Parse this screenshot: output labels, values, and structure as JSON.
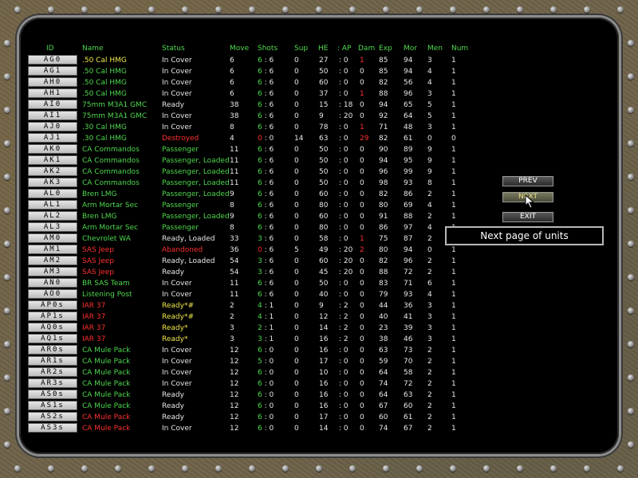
{
  "headers": {
    "id": "ID",
    "name": "Name",
    "status": "Status",
    "move": "Move",
    "shots": "Shots",
    "sup": "Sup",
    "he": "HE",
    "ap": ": AP",
    "dam": "Dam",
    "exp": "Exp",
    "mor": "Mor",
    "men": "Men",
    "num": "Num"
  },
  "buttons": {
    "prev": "PREV",
    "next": "NEXT",
    "exit": "EXIT"
  },
  "tooltip": "Next page of units",
  "colors": {
    "green": "#4fd84f",
    "red": "#ff3030",
    "yellow": "#f0e84a",
    "white": "#e8e8e8"
  },
  "units": [
    {
      "id": "AG0",
      "name": ".50 Cal HMG",
      "nc": "yellow",
      "status": "In Cover",
      "sc": "white",
      "move": "6",
      "sh1": "6",
      "sh1c": "green",
      "sh2": "6",
      "sup": "0",
      "he": "27",
      "ap": "0",
      "dam": "1",
      "damc": "red",
      "exp": "85",
      "mor": "94",
      "men": "3",
      "num": "1"
    },
    {
      "id": "AG1",
      "name": ".50 Cal HMG",
      "nc": "green",
      "status": "In Cover",
      "sc": "white",
      "move": "6",
      "sh1": "6",
      "sh1c": "green",
      "sh2": "6",
      "sup": "0",
      "he": "50",
      "ap": "0",
      "dam": "0",
      "damc": "white",
      "exp": "85",
      "mor": "94",
      "men": "4",
      "num": "1"
    },
    {
      "id": "AH0",
      "name": ".50 Cal HMG",
      "nc": "green",
      "status": "In Cover",
      "sc": "white",
      "move": "6",
      "sh1": "6",
      "sh1c": "green",
      "sh2": "6",
      "sup": "0",
      "he": "60",
      "ap": "0",
      "dam": "0",
      "damc": "white",
      "exp": "82",
      "mor": "56",
      "men": "4",
      "num": "1"
    },
    {
      "id": "AH1",
      "name": ".50 Cal HMG",
      "nc": "green",
      "status": "In Cover",
      "sc": "white",
      "move": "6",
      "sh1": "6",
      "sh1c": "green",
      "sh2": "6",
      "sup": "0",
      "he": "37",
      "ap": "0",
      "dam": "1",
      "damc": "red",
      "exp": "88",
      "mor": "96",
      "men": "3",
      "num": "1"
    },
    {
      "id": "AI0",
      "name": "75mm M3A1 GMC",
      "nc": "green",
      "status": "Ready",
      "sc": "white",
      "move": "38",
      "sh1": "6",
      "sh1c": "green",
      "sh2": "6",
      "sup": "0",
      "he": "15",
      "ap": "18",
      "dam": "0",
      "damc": "white",
      "exp": "94",
      "mor": "65",
      "men": "5",
      "num": "1"
    },
    {
      "id": "AI1",
      "name": "75mm M3A1 GMC",
      "nc": "green",
      "status": "In Cover",
      "sc": "white",
      "move": "38",
      "sh1": "6",
      "sh1c": "green",
      "sh2": "6",
      "sup": "0",
      "he": "9",
      "ap": "20",
      "dam": "0",
      "damc": "white",
      "exp": "92",
      "mor": "64",
      "men": "5",
      "num": "1"
    },
    {
      "id": "AJ0",
      "name": ".30 Cal HMG",
      "nc": "green",
      "status": "In Cover",
      "sc": "white",
      "move": "8",
      "sh1": "6",
      "sh1c": "green",
      "sh2": "6",
      "sup": "0",
      "he": "78",
      "ap": "0",
      "dam": "1",
      "damc": "red",
      "exp": "71",
      "mor": "48",
      "men": "3",
      "num": "1"
    },
    {
      "id": "AJ1",
      "name": ".30 Cal HMG",
      "nc": "green",
      "status": "Destroyed",
      "sc": "red",
      "move": "4",
      "sh1": "0",
      "sh1c": "red",
      "sh2": "0",
      "sup": "14",
      "he": "63",
      "ap": "0",
      "dam": "29",
      "damc": "red",
      "exp": "82",
      "mor": "61",
      "men": "0",
      "num": "0"
    },
    {
      "id": "AK0",
      "name": "CA Commandos",
      "nc": "green",
      "status": "Passenger",
      "sc": "green",
      "move": "11",
      "sh1": "6",
      "sh1c": "green",
      "sh2": "6",
      "sup": "0",
      "he": "50",
      "ap": "0",
      "dam": "0",
      "damc": "white",
      "exp": "90",
      "mor": "89",
      "men": "9",
      "num": "1"
    },
    {
      "id": "AK1",
      "name": "CA Commandos",
      "nc": "green",
      "status": "Passenger,  Loaded",
      "sc": "green",
      "move": "11",
      "sh1": "6",
      "sh1c": "green",
      "sh2": "6",
      "sup": "0",
      "he": "50",
      "ap": "0",
      "dam": "0",
      "damc": "white",
      "exp": "94",
      "mor": "95",
      "men": "9",
      "num": "1"
    },
    {
      "id": "AK2",
      "name": "CA Commandos",
      "nc": "green",
      "status": "Passenger,  Loaded",
      "sc": "green",
      "move": "11",
      "sh1": "6",
      "sh1c": "green",
      "sh2": "6",
      "sup": "0",
      "he": "50",
      "ap": "0",
      "dam": "0",
      "damc": "white",
      "exp": "96",
      "mor": "99",
      "men": "9",
      "num": "1"
    },
    {
      "id": "AK3",
      "name": "CA Commandos",
      "nc": "green",
      "status": "Passenger,  Loaded",
      "sc": "green",
      "move": "11",
      "sh1": "6",
      "sh1c": "green",
      "sh2": "6",
      "sup": "0",
      "he": "50",
      "ap": "0",
      "dam": "0",
      "damc": "white",
      "exp": "98",
      "mor": "93",
      "men": "8",
      "num": "1"
    },
    {
      "id": "AL0",
      "name": "Bren LMG",
      "nc": "green",
      "status": "Passenger,  Loaded",
      "sc": "green",
      "move": "9",
      "sh1": "6",
      "sh1c": "green",
      "sh2": "6",
      "sup": "0",
      "he": "60",
      "ap": "0",
      "dam": "0",
      "damc": "white",
      "exp": "82",
      "mor": "86",
      "men": "2",
      "num": "1"
    },
    {
      "id": "AL1",
      "name": "Arm Mortar Sec",
      "nc": "green",
      "status": "Passenger",
      "sc": "green",
      "move": "8",
      "sh1": "6",
      "sh1c": "green",
      "sh2": "6",
      "sup": "0",
      "he": "80",
      "ap": "0",
      "dam": "0",
      "damc": "white",
      "exp": "80",
      "mor": "69",
      "men": "4",
      "num": "1"
    },
    {
      "id": "AL2",
      "name": "Bren LMG",
      "nc": "green",
      "status": "Passenger,  Loaded",
      "sc": "green",
      "move": "9",
      "sh1": "6",
      "sh1c": "green",
      "sh2": "6",
      "sup": "0",
      "he": "60",
      "ap": "0",
      "dam": "0",
      "damc": "white",
      "exp": "91",
      "mor": "88",
      "men": "2",
      "num": "1"
    },
    {
      "id": "AL3",
      "name": "Arm Mortar Sec",
      "nc": "green",
      "status": "Passenger",
      "sc": "green",
      "move": "8",
      "sh1": "6",
      "sh1c": "green",
      "sh2": "6",
      "sup": "0",
      "he": "80",
      "ap": "0",
      "dam": "0",
      "damc": "white",
      "exp": "86",
      "mor": "97",
      "men": "4",
      "num": "1"
    },
    {
      "id": "AM0",
      "name": "Chevrolet WA",
      "nc": "green",
      "status": "Ready,  Loaded",
      "sc": "white",
      "move": "33",
      "sh1": "3",
      "sh1c": "green",
      "sh2": "6",
      "sup": "0",
      "he": "58",
      "ap": "0",
      "dam": "1",
      "damc": "red",
      "exp": "75",
      "mor": "87",
      "men": "2",
      "num": "1"
    },
    {
      "id": "AM1",
      "name": "SAS Jeep",
      "nc": "red",
      "status": "Abandoned",
      "sc": "red",
      "move": "36",
      "sh1": "0",
      "sh1c": "red",
      "sh2": "6",
      "sup": "5",
      "he": "49",
      "ap": "20",
      "dam": "2",
      "damc": "red",
      "exp": "80",
      "mor": "94",
      "men": "0",
      "num": "1"
    },
    {
      "id": "AM2",
      "name": "SAS Jeep",
      "nc": "red",
      "status": "Ready,  Loaded",
      "sc": "white",
      "move": "54",
      "sh1": "3",
      "sh1c": "green",
      "sh2": "6",
      "sup": "0",
      "he": "60",
      "ap": "20",
      "dam": "0",
      "damc": "white",
      "exp": "82",
      "mor": "96",
      "men": "2",
      "num": "1"
    },
    {
      "id": "AM3",
      "name": "SAS Jeep",
      "nc": "red",
      "status": "Ready",
      "sc": "white",
      "move": "54",
      "sh1": "3",
      "sh1c": "green",
      "sh2": "6",
      "sup": "0",
      "he": "45",
      "ap": "20",
      "dam": "0",
      "damc": "white",
      "exp": "88",
      "mor": "72",
      "men": "2",
      "num": "1"
    },
    {
      "id": "AN0",
      "name": "BR SAS Team",
      "nc": "green",
      "status": "In Cover",
      "sc": "white",
      "move": "11",
      "sh1": "6",
      "sh1c": "green",
      "sh2": "6",
      "sup": "0",
      "he": "50",
      "ap": "0",
      "dam": "0",
      "damc": "white",
      "exp": "83",
      "mor": "71",
      "men": "6",
      "num": "1"
    },
    {
      "id": "AO0",
      "name": "Listening Post",
      "nc": "green",
      "status": "In Cover",
      "sc": "white",
      "move": "11",
      "sh1": "6",
      "sh1c": "green",
      "sh2": "6",
      "sup": "0",
      "he": "40",
      "ap": "0",
      "dam": "0",
      "damc": "white",
      "exp": "79",
      "mor": "93",
      "men": "4",
      "num": "1"
    },
    {
      "id": "AP0s",
      "name": "IAR 37",
      "nc": "red",
      "status": "Ready*#",
      "sc": "yellow",
      "move": "2",
      "sh1": "4",
      "sh1c": "green",
      "sh2": "1",
      "sup": "0",
      "he": "9",
      "ap": "2",
      "dam": "0",
      "damc": "white",
      "exp": "44",
      "mor": "36",
      "men": "3",
      "num": "1"
    },
    {
      "id": "AP1s",
      "name": "IAR 37",
      "nc": "red",
      "status": "Ready*#",
      "sc": "yellow",
      "move": "2",
      "sh1": "4",
      "sh1c": "green",
      "sh2": "1",
      "sup": "0",
      "he": "12",
      "ap": "2",
      "dam": "0",
      "damc": "white",
      "exp": "40",
      "mor": "41",
      "men": "3",
      "num": "1"
    },
    {
      "id": "AQ0s",
      "name": "IAR 37",
      "nc": "red",
      "status": "Ready*",
      "sc": "yellow",
      "move": "3",
      "sh1": "2",
      "sh1c": "green",
      "sh2": "1",
      "sup": "0",
      "he": "14",
      "ap": "2",
      "dam": "0",
      "damc": "white",
      "exp": "23",
      "mor": "39",
      "men": "3",
      "num": "1"
    },
    {
      "id": "AQ1s",
      "name": "IAR 37",
      "nc": "red",
      "status": "Ready*",
      "sc": "yellow",
      "move": "3",
      "sh1": "3",
      "sh1c": "green",
      "sh2": "1",
      "sup": "0",
      "he": "16",
      "ap": "2",
      "dam": "0",
      "damc": "white",
      "exp": "38",
      "mor": "46",
      "men": "3",
      "num": "1"
    },
    {
      "id": "AR0s",
      "name": "CA Mule Pack",
      "nc": "green",
      "status": "In Cover",
      "sc": "white",
      "move": "12",
      "sh1": "6",
      "sh1c": "green",
      "sh2": "0",
      "sup": "0",
      "he": "16",
      "ap": "0",
      "dam": "0",
      "damc": "white",
      "exp": "63",
      "mor": "73",
      "men": "2",
      "num": "1"
    },
    {
      "id": "AR1s",
      "name": "CA Mule Pack",
      "nc": "green",
      "status": "In Cover",
      "sc": "white",
      "move": "12",
      "sh1": "5",
      "sh1c": "green",
      "sh2": "0",
      "sup": "0",
      "he": "17",
      "ap": "0",
      "dam": "0",
      "damc": "white",
      "exp": "59",
      "mor": "70",
      "men": "2",
      "num": "1"
    },
    {
      "id": "AR2s",
      "name": "CA Mule Pack",
      "nc": "green",
      "status": "In Cover",
      "sc": "white",
      "move": "12",
      "sh1": "6",
      "sh1c": "green",
      "sh2": "0",
      "sup": "0",
      "he": "10",
      "ap": "0",
      "dam": "0",
      "damc": "white",
      "exp": "64",
      "mor": "58",
      "men": "2",
      "num": "1"
    },
    {
      "id": "AR3s",
      "name": "CA Mule Pack",
      "nc": "green",
      "status": "In Cover",
      "sc": "white",
      "move": "12",
      "sh1": "6",
      "sh1c": "green",
      "sh2": "0",
      "sup": "0",
      "he": "16",
      "ap": "0",
      "dam": "0",
      "damc": "white",
      "exp": "74",
      "mor": "72",
      "men": "2",
      "num": "1"
    },
    {
      "id": "AS0s",
      "name": "CA Mule Pack",
      "nc": "green",
      "status": "Ready",
      "sc": "white",
      "move": "12",
      "sh1": "6",
      "sh1c": "green",
      "sh2": "0",
      "sup": "0",
      "he": "16",
      "ap": "0",
      "dam": "0",
      "damc": "white",
      "exp": "64",
      "mor": "63",
      "men": "2",
      "num": "1"
    },
    {
      "id": "AS1s",
      "name": "CA Mule Pack",
      "nc": "green",
      "status": "Ready",
      "sc": "white",
      "move": "12",
      "sh1": "6",
      "sh1c": "green",
      "sh2": "0",
      "sup": "0",
      "he": "16",
      "ap": "0",
      "dam": "0",
      "damc": "white",
      "exp": "67",
      "mor": "60",
      "men": "2",
      "num": "1"
    },
    {
      "id": "AS2s",
      "name": "CA Mule Pack",
      "nc": "red",
      "status": "Ready",
      "sc": "white",
      "move": "12",
      "sh1": "6",
      "sh1c": "green",
      "sh2": "0",
      "sup": "0",
      "he": "17",
      "ap": "0",
      "dam": "0",
      "damc": "white",
      "exp": "60",
      "mor": "61",
      "men": "2",
      "num": "1"
    },
    {
      "id": "AS3s",
      "name": "CA Mule Pack",
      "nc": "red",
      "status": "In Cover",
      "sc": "white",
      "move": "12",
      "sh1": "6",
      "sh1c": "green",
      "sh2": "0",
      "sup": "0",
      "he": "14",
      "ap": "0",
      "dam": "0",
      "damc": "white",
      "exp": "74",
      "mor": "67",
      "men": "2",
      "num": "1"
    }
  ]
}
